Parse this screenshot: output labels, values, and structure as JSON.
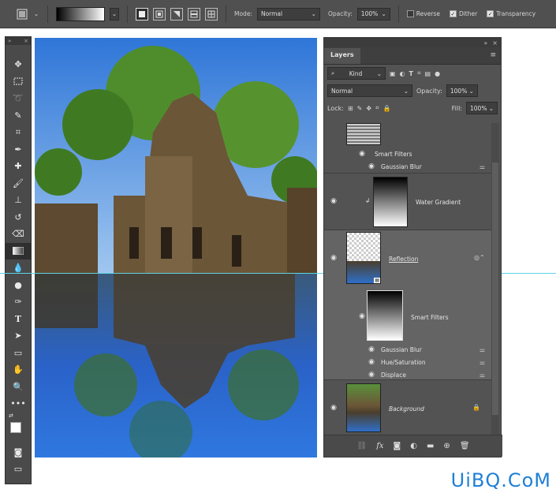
{
  "options_bar": {
    "mode_label": "Mode:",
    "mode_value": "Normal",
    "opacity_label": "Opacity:",
    "opacity_value": "100%",
    "reverse_label": "Reverse",
    "reverse_checked": false,
    "dither_label": "Dither",
    "dither_checked": true,
    "transparency_label": "Transparency",
    "transparency_checked": true,
    "gradient_types": [
      "linear-gradient-icon",
      "radial-gradient-icon",
      "angle-gradient-icon",
      "reflected-gradient-icon",
      "diamond-gradient-icon"
    ]
  },
  "toolbar": {
    "tools": [
      "move-icon",
      "marquee-icon",
      "lasso-icon",
      "quick-select-icon",
      "crop-icon",
      "eyedropper-icon",
      "healing-brush-icon",
      "brush-icon",
      "clone-stamp-icon",
      "history-brush-icon",
      "eraser-icon",
      "gradient-icon",
      "blur-icon",
      "dodge-icon",
      "pen-icon",
      "type-icon",
      "path-select-icon",
      "shape-icon",
      "hand-icon",
      "zoom-icon",
      "more-icon"
    ],
    "selected_tool": "gradient-icon"
  },
  "layers_panel": {
    "tab": "Layers",
    "filter_kind": "Kind",
    "blend_mode": "Normal",
    "opacity_label": "Opacity:",
    "opacity_value": "100%",
    "lock_label": "Lock:",
    "fill_label": "Fill:",
    "fill_value": "100%",
    "layers": [
      {
        "name": "Smart Filters",
        "filters": [
          "Gaussian Blur"
        ]
      },
      {
        "name": "Water Gradient"
      },
      {
        "name": "Reflection",
        "selected": true,
        "smart_filters_label": "Smart Filters",
        "filters": [
          "Gaussian Blur",
          "Hue/Saturation",
          "Displace"
        ]
      },
      {
        "name": "Background",
        "locked": true
      }
    ]
  },
  "watermark": "UiBQ.CoM"
}
